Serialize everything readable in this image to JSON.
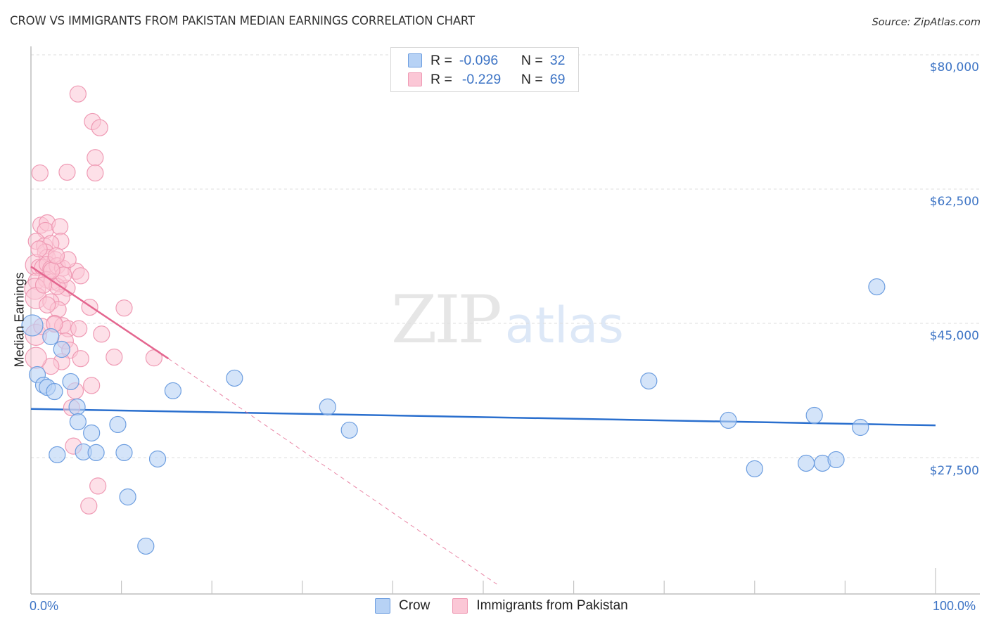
{
  "chart_data": {
    "type": "scatter",
    "title": "CROW VS IMMIGRANTS FROM PAKISTAN MEDIAN EARNINGS CORRELATION CHART",
    "source": "Source: ZipAtlas.com",
    "xlabel": "",
    "ylabel": "Median Earnings",
    "xlim": [
      0,
      100
    ],
    "ylim": [
      10500,
      83000
    ],
    "x_tick_labels": [
      {
        "value": 0,
        "label": "0.0%"
      },
      {
        "value": 100,
        "label": "100.0%"
      }
    ],
    "x_minor_ticks": [
      10,
      20,
      30,
      40,
      50,
      60,
      70,
      80,
      90,
      100
    ],
    "y_ticks": [
      {
        "value": 80000,
        "label": "$80,000"
      },
      {
        "value": 62500,
        "label": "$62,500"
      },
      {
        "value": 45000,
        "label": "$45,000"
      },
      {
        "value": 27500,
        "label": "$27,500"
      }
    ],
    "grid": true,
    "legend_top": [
      {
        "series": "Crow",
        "r_label": "R =",
        "r": "-0.096",
        "n_label": "N =",
        "n": "32"
      },
      {
        "series": "Immigrants from Pakistan",
        "r_label": "R =",
        "r": "-0.229",
        "n_label": "N =",
        "n": "69"
      }
    ],
    "legend_position": "bottom-center",
    "watermark": {
      "zip": "ZIP",
      "atlas": "atlas"
    },
    "series": [
      {
        "name": "Crow",
        "color": "#6d9ee0",
        "fill": "#b7d2f5",
        "trend": {
          "x0": 0,
          "y0": 33850,
          "x1": 100,
          "y1": 31700,
          "color": "#2a6fce"
        },
        "points": [
          [
            93.5,
            49760
          ],
          [
            68.3,
            37490
          ],
          [
            22.5,
            37860
          ],
          [
            15.7,
            36210
          ],
          [
            32.8,
            34100
          ],
          [
            35.2,
            31080
          ],
          [
            77.1,
            32360
          ],
          [
            86.6,
            33000
          ],
          [
            91.7,
            31440
          ],
          [
            80.0,
            26040
          ],
          [
            85.7,
            26770
          ],
          [
            87.5,
            26770
          ],
          [
            89.0,
            27230
          ],
          [
            0.0,
            44730
          ],
          [
            2.2,
            43260
          ],
          [
            3.4,
            41610
          ],
          [
            0.7,
            38310
          ],
          [
            1.4,
            36940
          ],
          [
            1.8,
            36660
          ],
          [
            2.6,
            36110
          ],
          [
            4.4,
            37400
          ],
          [
            5.1,
            34100
          ],
          [
            5.2,
            32170
          ],
          [
            2.9,
            27870
          ],
          [
            5.8,
            28240
          ],
          [
            6.7,
            30710
          ],
          [
            7.2,
            28150
          ],
          [
            9.6,
            31810
          ],
          [
            10.3,
            28150
          ],
          [
            14.0,
            27320
          ],
          [
            10.7,
            22370
          ],
          [
            12.7,
            15960
          ]
        ]
      },
      {
        "name": "Immigrants from Pakistan",
        "color": "#ef9ab4",
        "fill": "#fbc7d6",
        "trend": {
          "x0": 0,
          "y0": 52400,
          "x1": 15.2,
          "y1": 40400,
          "x2": 51.5,
          "y2": 11000,
          "color": "#e4668f"
        },
        "points": [
          [
            5.2,
            74900
          ],
          [
            6.8,
            71300
          ],
          [
            7.6,
            70500
          ],
          [
            7.1,
            66600
          ],
          [
            7.1,
            64600
          ],
          [
            1.0,
            64600
          ],
          [
            4.0,
            64700
          ],
          [
            1.1,
            57800
          ],
          [
            1.8,
            58100
          ],
          [
            1.6,
            57100
          ],
          [
            3.2,
            57600
          ],
          [
            0.6,
            55700
          ],
          [
            1.5,
            55100
          ],
          [
            3.3,
            55700
          ],
          [
            2.2,
            55400
          ],
          [
            1.6,
            54300
          ],
          [
            1.8,
            53600
          ],
          [
            2.7,
            53300
          ],
          [
            0.4,
            52600
          ],
          [
            0.9,
            52300
          ],
          [
            1.3,
            52300
          ],
          [
            1.8,
            52700
          ],
          [
            2.2,
            52100
          ],
          [
            2.9,
            52500
          ],
          [
            3.5,
            52200
          ],
          [
            5.0,
            51800
          ],
          [
            5.5,
            51200
          ],
          [
            0.6,
            50500
          ],
          [
            1.7,
            50700
          ],
          [
            2.3,
            50400
          ],
          [
            3.1,
            50200
          ],
          [
            4.0,
            49600
          ],
          [
            0.3,
            49500
          ],
          [
            0.4,
            48300
          ],
          [
            3.4,
            48400
          ],
          [
            2.2,
            47800
          ],
          [
            3.0,
            46800
          ],
          [
            6.5,
            47100
          ],
          [
            10.3,
            47000
          ],
          [
            2.6,
            45000
          ],
          [
            3.5,
            44700
          ],
          [
            4.1,
            44300
          ],
          [
            5.3,
            44300
          ],
          [
            7.8,
            43600
          ],
          [
            0.4,
            43500
          ],
          [
            3.8,
            42700
          ],
          [
            4.3,
            41500
          ],
          [
            3.4,
            40000
          ],
          [
            5.5,
            40400
          ],
          [
            9.2,
            40600
          ],
          [
            13.6,
            40500
          ],
          [
            2.2,
            39400
          ],
          [
            4.9,
            36200
          ],
          [
            6.7,
            36900
          ],
          [
            4.5,
            34000
          ],
          [
            4.7,
            29000
          ],
          [
            7.4,
            23800
          ],
          [
            6.4,
            21200
          ],
          [
            0.4,
            40500
          ],
          [
            1.2,
            44600
          ],
          [
            2.6,
            44900
          ],
          [
            1.8,
            47400
          ],
          [
            2.9,
            49800
          ],
          [
            3.6,
            51300
          ],
          [
            0.9,
            54700
          ],
          [
            2.3,
            51900
          ],
          [
            4.1,
            53300
          ],
          [
            1.4,
            50000
          ],
          [
            2.8,
            53800
          ]
        ]
      }
    ]
  }
}
